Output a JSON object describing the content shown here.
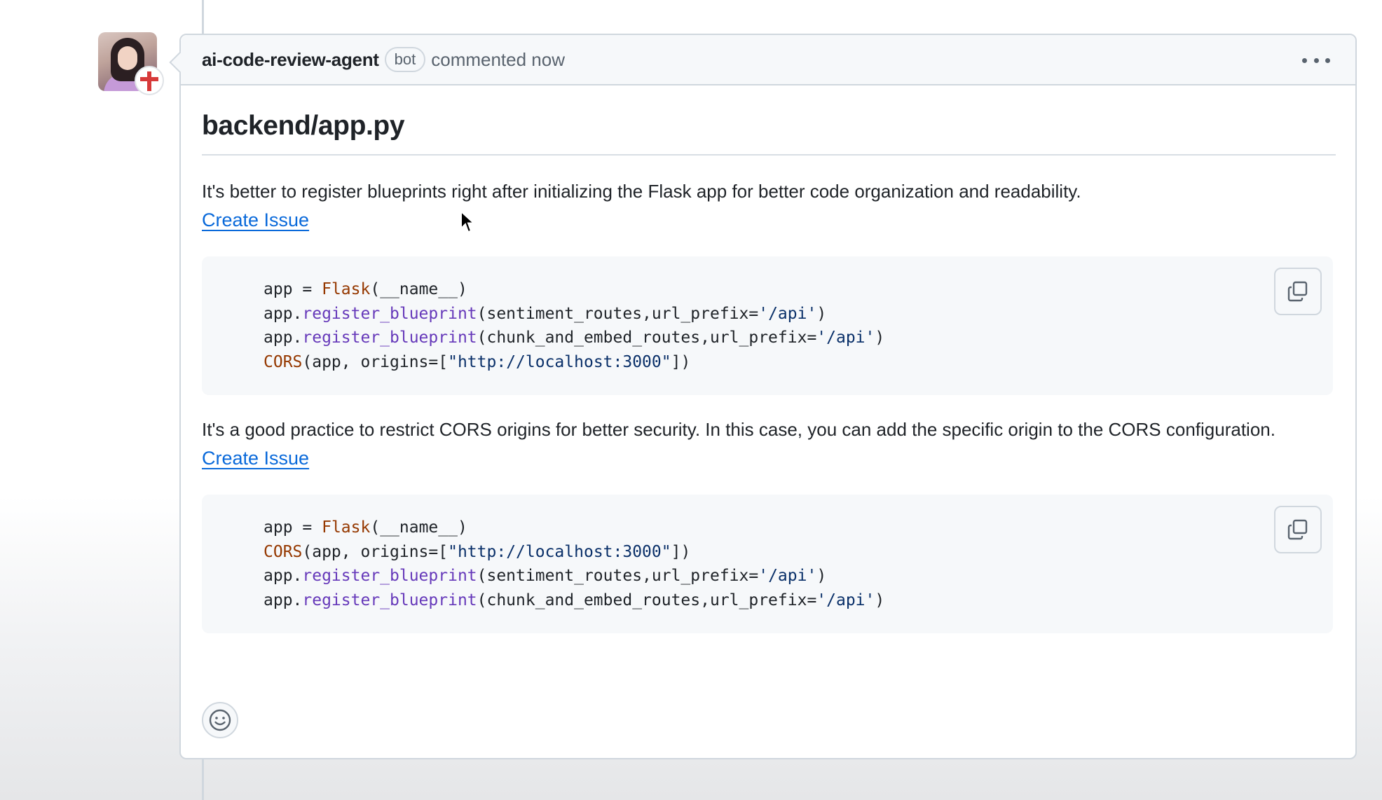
{
  "comment": {
    "author": "ai-code-review-agent",
    "badge": "bot",
    "action_text": "commented now"
  },
  "icons": {
    "menu": "kebab-horizontal-icon",
    "copy": "copy-icon",
    "reaction": "smiley-icon",
    "avatar_badge": "red-cross-badge-icon"
  },
  "body": {
    "file_heading": "backend/app.py",
    "suggestions": [
      {
        "text": "It's better to register blueprints right after initializing the Flask app for better code organization and readability.",
        "link_label": "Create Issue"
      },
      {
        "text": "It's a good practice to restrict CORS origins for better security. In this case, you can add the specific origin to the CORS configuration.",
        "link_label": "Create Issue"
      }
    ]
  },
  "code_blocks": [
    {
      "lines": [
        {
          "parts": [
            {
              "t": "app = ",
              "c": "plain"
            },
            {
              "t": "Flask",
              "c": "cls"
            },
            {
              "t": "(__name__)",
              "c": "plain"
            }
          ]
        },
        {
          "parts": [
            {
              "t": "app.",
              "c": "plain"
            },
            {
              "t": "register_blueprint",
              "c": "fn"
            },
            {
              "t": "(sentiment_routes,url_prefix=",
              "c": "plain"
            },
            {
              "t": "'/api'",
              "c": "str"
            },
            {
              "t": ")",
              "c": "plain"
            }
          ]
        },
        {
          "parts": [
            {
              "t": "app.",
              "c": "plain"
            },
            {
              "t": "register_blueprint",
              "c": "fn"
            },
            {
              "t": "(chunk_and_embed_routes,url_prefix=",
              "c": "plain"
            },
            {
              "t": "'/api'",
              "c": "str"
            },
            {
              "t": ")",
              "c": "plain"
            }
          ]
        },
        {
          "parts": [
            {
              "t": "CORS",
              "c": "cls"
            },
            {
              "t": "(app, origins=[",
              "c": "plain"
            },
            {
              "t": "\"http://localhost:3000\"",
              "c": "str"
            },
            {
              "t": "])",
              "c": "plain"
            }
          ]
        }
      ]
    },
    {
      "lines": [
        {
          "parts": [
            {
              "t": "app = ",
              "c": "plain"
            },
            {
              "t": "Flask",
              "c": "cls"
            },
            {
              "t": "(__name__)",
              "c": "plain"
            }
          ]
        },
        {
          "parts": [
            {
              "t": "CORS",
              "c": "cls"
            },
            {
              "t": "(app, origins=[",
              "c": "plain"
            },
            {
              "t": "\"http://localhost:3000\"",
              "c": "str"
            },
            {
              "t": "])",
              "c": "plain"
            }
          ]
        },
        {
          "parts": [
            {
              "t": "app.",
              "c": "plain"
            },
            {
              "t": "register_blueprint",
              "c": "fn"
            },
            {
              "t": "(sentiment_routes,url_prefix=",
              "c": "plain"
            },
            {
              "t": "'/api'",
              "c": "str"
            },
            {
              "t": ")",
              "c": "plain"
            }
          ]
        },
        {
          "parts": [
            {
              "t": "app.",
              "c": "plain"
            },
            {
              "t": "register_blueprint",
              "c": "fn"
            },
            {
              "t": "(chunk_and_embed_routes,url_prefix=",
              "c": "plain"
            },
            {
              "t": "'/api'",
              "c": "str"
            },
            {
              "t": ")",
              "c": "plain"
            }
          ]
        }
      ]
    }
  ],
  "colors": {
    "link": "#0969da",
    "border": "#d0d7de",
    "header_bg": "#f6f8fa",
    "code_bg": "#f6f8fa",
    "syntax_function": "#6639ba",
    "syntax_class": "#953800",
    "syntax_string": "#0a3069"
  }
}
